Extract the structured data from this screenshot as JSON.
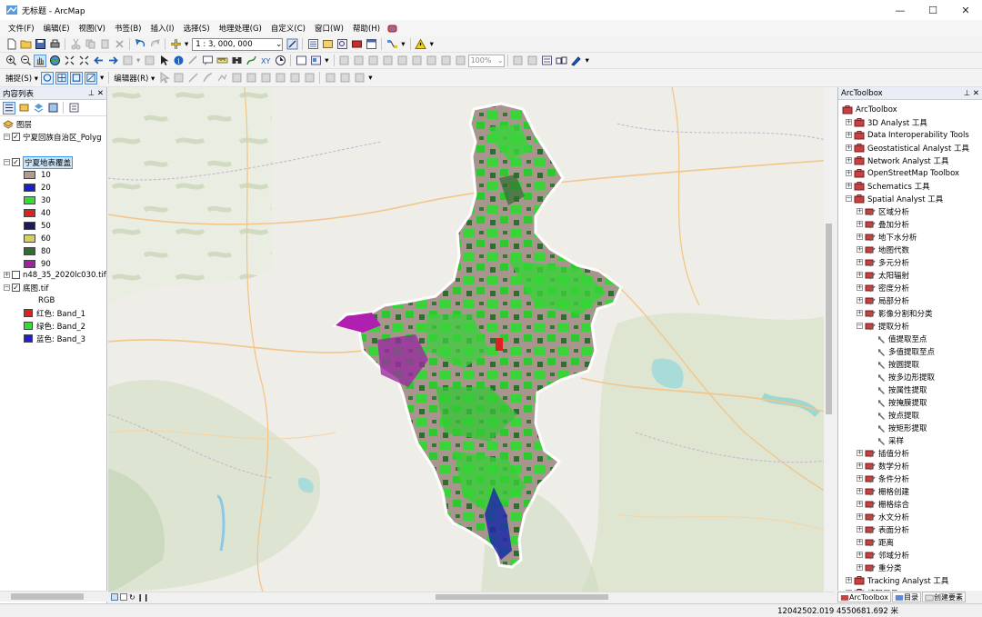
{
  "window": {
    "title": "无标题 - ArcMap",
    "minimize": "—",
    "maximize": "☐",
    "close": "✕"
  },
  "menu": [
    "文件(F)",
    "编辑(E)",
    "视图(V)",
    "书签(B)",
    "插入(I)",
    "选择(S)",
    "地理处理(G)",
    "自定义(C)",
    "窗口(W)",
    "帮助(H)"
  ],
  "toolbar": {
    "scale": "1 : 3, 000, 000",
    "zoom_percent": "100%",
    "snapping_label": "捕捉(S) ▾",
    "editor_label": "编辑器(R) ▾"
  },
  "toc": {
    "title": "内容列表",
    "root": "图层",
    "layers": {
      "polygon": "宁夏回族自治区_Polyg",
      "landcover": "宁夏地表覆盖",
      "tile": "n48_35_2020lc030.tif",
      "basemap": "底图.tif"
    },
    "classes": [
      {
        "label": "10",
        "color": "#b29b8b"
      },
      {
        "label": "20",
        "color": "#1e1ec8"
      },
      {
        "label": "30",
        "color": "#33dd33"
      },
      {
        "label": "40",
        "color": "#dd2020"
      },
      {
        "label": "50",
        "color": "#1a1a5a"
      },
      {
        "label": "60",
        "color": "#d8d050"
      },
      {
        "label": "80",
        "color": "#2e6e2e"
      },
      {
        "label": "90",
        "color": "#a020a0"
      }
    ],
    "rgb": {
      "label": "RGB",
      "bands": [
        {
          "label": "红色:   Band_1",
          "color": "#e02020"
        },
        {
          "label": "绿色:   Band_2",
          "color": "#30e030"
        },
        {
          "label": "蓝色:   Band_3",
          "color": "#2020d0"
        }
      ]
    }
  },
  "arctoolbox": {
    "title": "ArcToolbox",
    "root": "ArcToolbox",
    "toolboxes": [
      "3D Analyst 工具",
      "Data Interoperability Tools",
      "Geostatistical Analyst 工具",
      "Network Analyst 工具",
      "OpenStreetMap Toolbox",
      "Schematics 工具"
    ],
    "spatial": "Spatial Analyst 工具",
    "spatial_children_a": [
      "区域分析",
      "叠加分析",
      "地下水分析",
      "地图代数",
      "多元分析",
      "太阳辐射",
      "密度分析",
      "局部分析",
      "影像分割和分类"
    ],
    "extract": "提取分析",
    "extract_tools": [
      "值提取至点",
      "多值提取至点",
      "按圆提取",
      "按多边形提取",
      "按属性提取",
      "按掩膜提取",
      "按点提取",
      "按矩形提取",
      "采样"
    ],
    "spatial_children_b": [
      "插值分析",
      "数学分析",
      "条件分析",
      "栅格创建",
      "栅格综合",
      "水文分析",
      "表面分析",
      "距离",
      "邻域分析",
      "重分类"
    ],
    "after": [
      "Tracking Analyst 工具",
      "编辑工具"
    ],
    "tabs": [
      "ArcToolbox",
      "目录",
      "创建要素"
    ]
  },
  "status": {
    "coords": "12042502.019  4550681.692 米"
  }
}
